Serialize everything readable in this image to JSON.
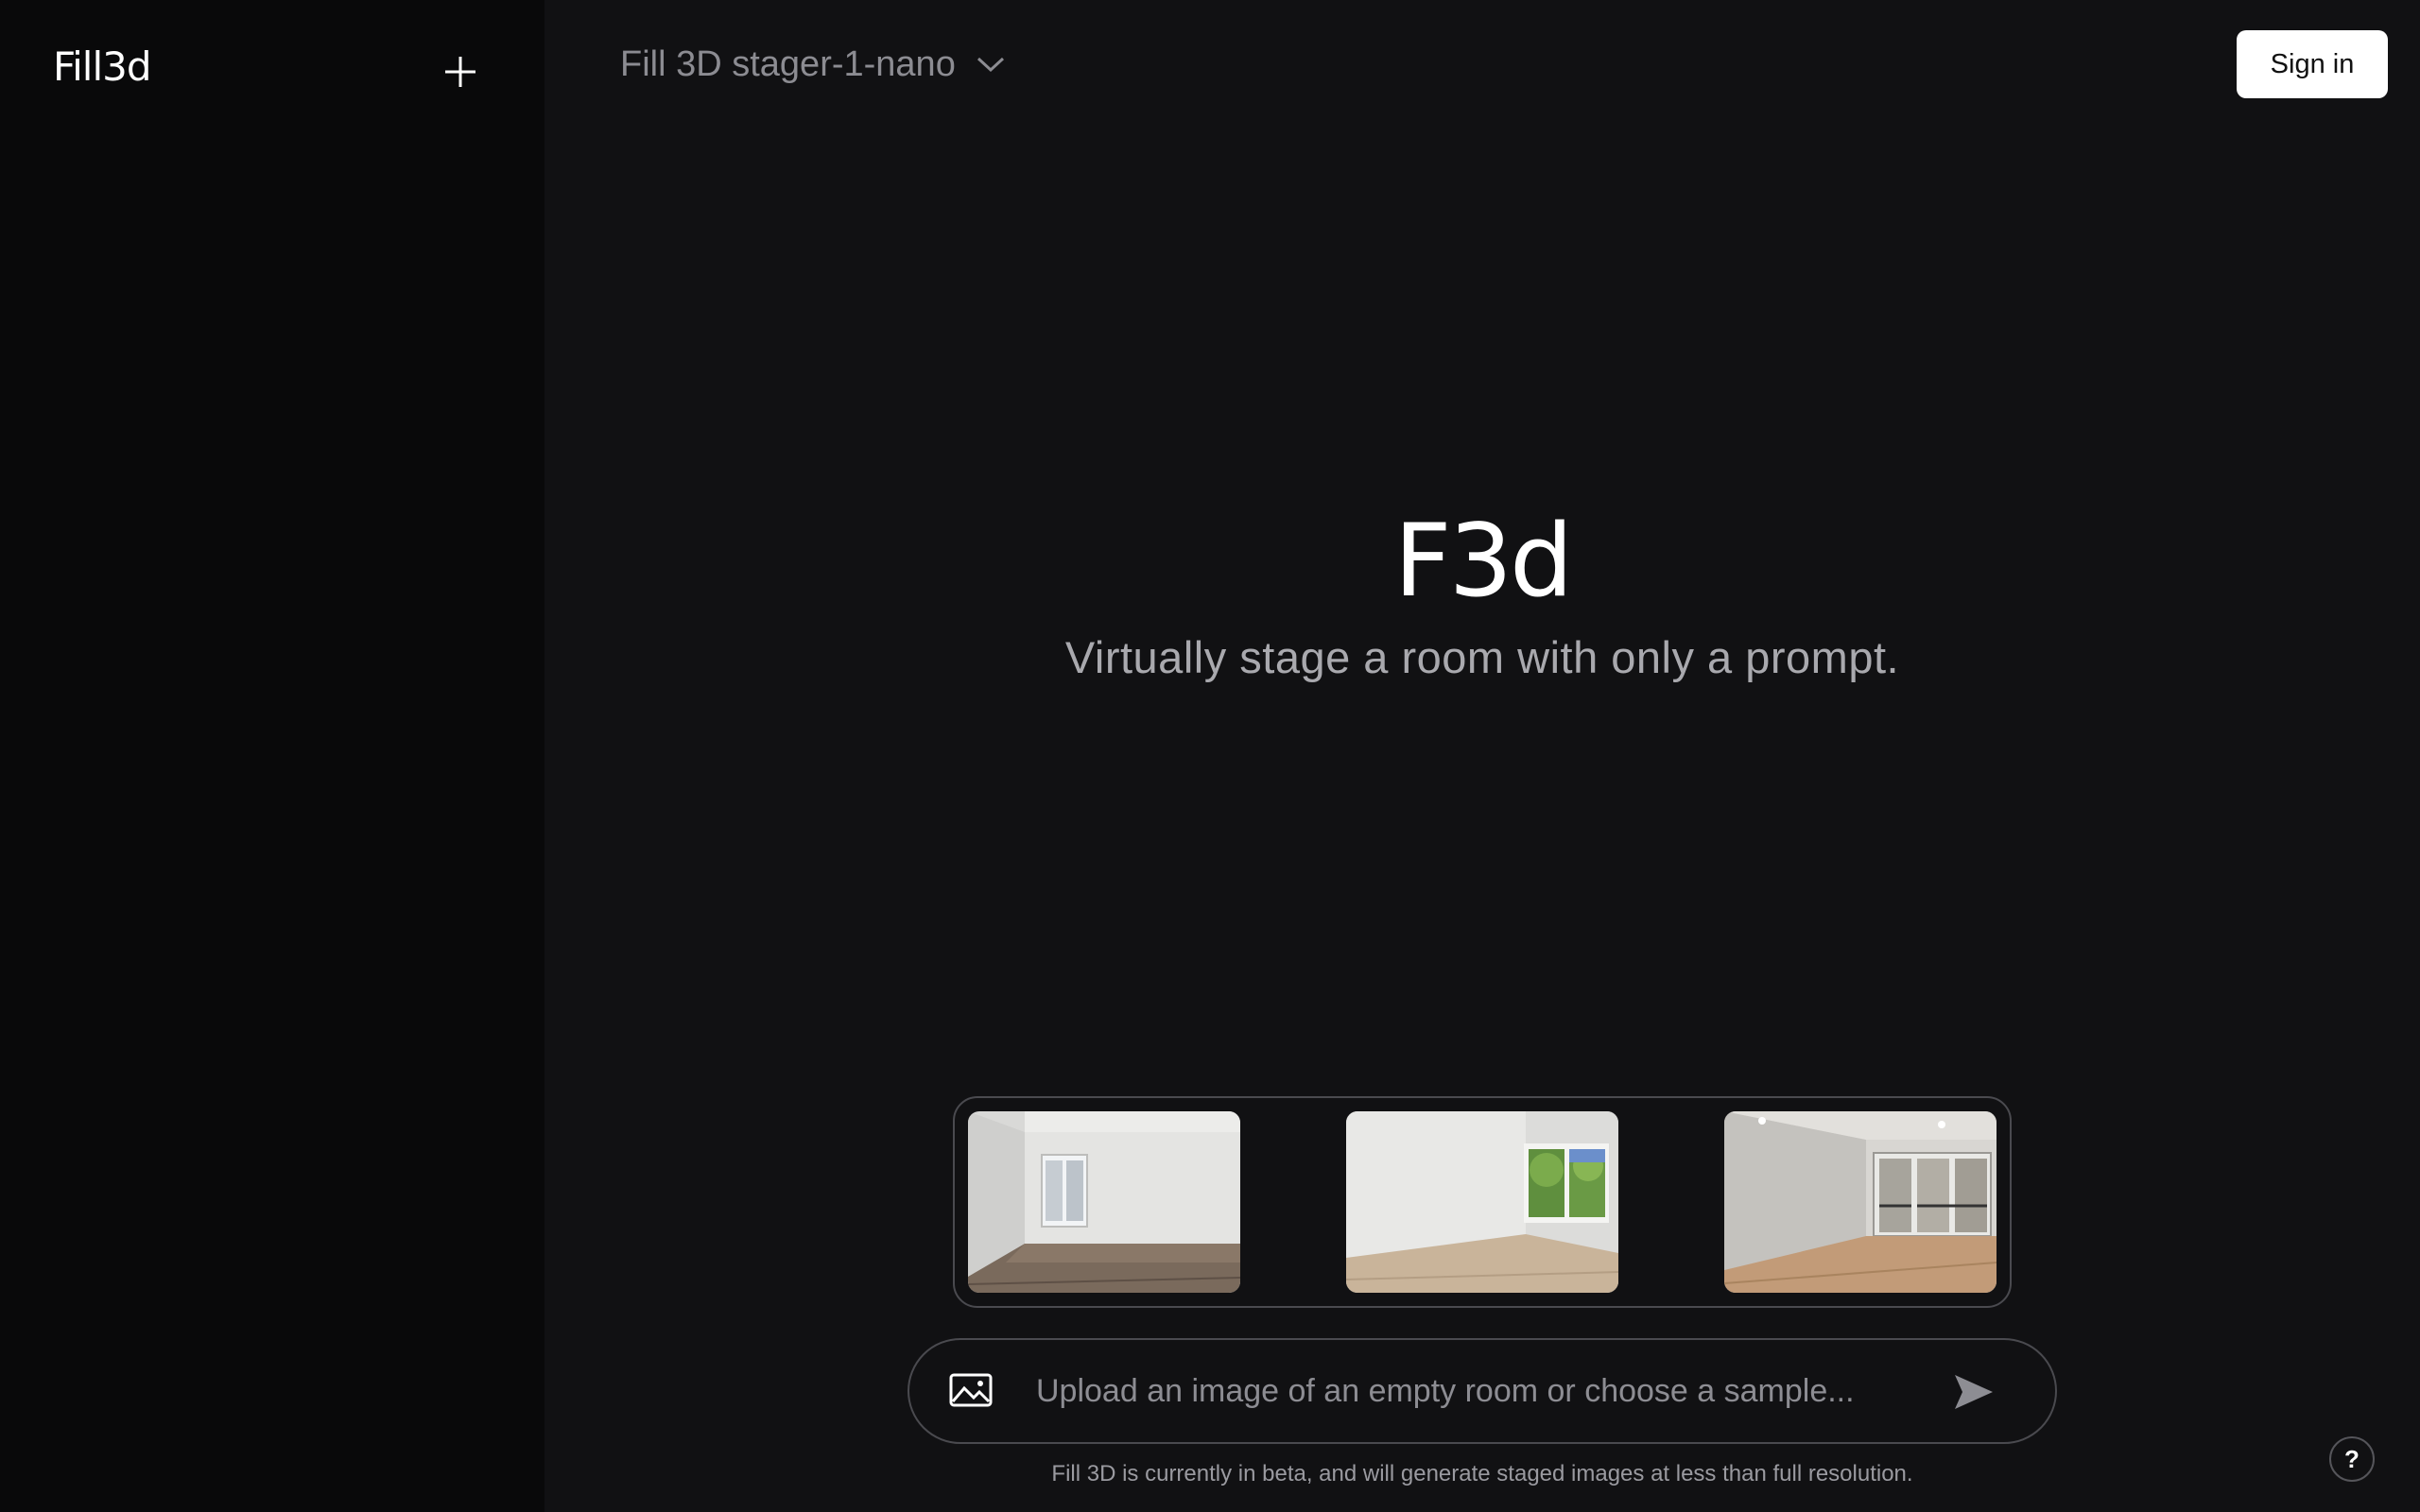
{
  "sidebar": {
    "logo": "Fill3d"
  },
  "header": {
    "model_name": "Fill 3D stager-1-nano",
    "sign_in_label": "Sign in"
  },
  "hero": {
    "logo": "F3d",
    "tagline": "Virtually stage a room with only a prompt."
  },
  "samples": [
    {
      "name": "sample-room-1"
    },
    {
      "name": "sample-room-2"
    },
    {
      "name": "sample-room-3"
    }
  ],
  "composer": {
    "placeholder": "Upload an image of an empty room or choose a sample..."
  },
  "footer": {
    "disclaimer": "Fill 3D is currently in beta, and will generate staged images at less than full resolution.",
    "help_label": "?"
  },
  "colors": {
    "background": "#111113",
    "sidebar": "#09090a",
    "accent_button": "#ffffff"
  }
}
